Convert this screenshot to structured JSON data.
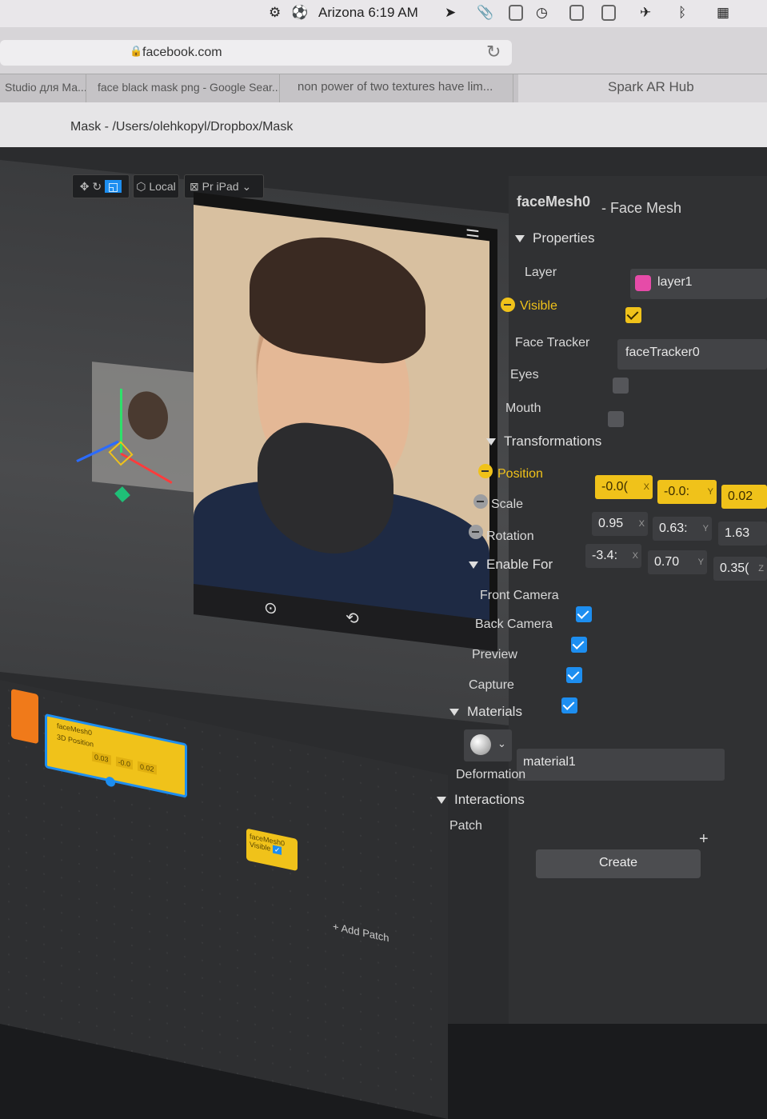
{
  "menubar": {
    "clock": "Arizona 6:19 AM"
  },
  "browser": {
    "url": "facebook.com",
    "tabs": [
      "Studio для Ма...",
      "face black mask png - Google Sear...",
      "non power of two textures have lim...",
      "Spark AR Hub"
    ]
  },
  "window": {
    "title": "Mask - /Users/olehkopyl/Dropbox/Mask"
  },
  "toolbar": {
    "space_label": "Local",
    "device_label": "iPad",
    "view_label": "Pr"
  },
  "inspector": {
    "object_name": "faceMesh0",
    "object_type": "- Face Mesh",
    "properties": {
      "header": "Properties",
      "layer_label": "Layer",
      "layer_value": "layer1",
      "visible_label": "Visible",
      "facetracker_label": "Face Tracker",
      "facetracker_value": "faceTracker0",
      "eyes_label": "Eyes",
      "mouth_label": "Mouth"
    },
    "transformations": {
      "header": "Transformations",
      "position_label": "Position",
      "position": [
        "-0.0(",
        "-0.0:",
        "0.02"
      ],
      "scale_label": "Scale",
      "scale": [
        "0.95",
        "0.63:",
        "1.63"
      ],
      "rotation_label": "Rotation",
      "rotation": [
        "-3.4:",
        "0.70",
        "0.35("
      ]
    },
    "axis": {
      "x": "X",
      "y": "Y",
      "z": "Z"
    },
    "enable_for": {
      "header": "Enable For",
      "front_camera": "Front Camera",
      "back_camera": "Back Camera",
      "preview": "Preview",
      "capture": "Capture"
    },
    "materials": {
      "header": "Materials",
      "value": "material1"
    },
    "deformation": {
      "header": "Deformation"
    },
    "interactions": {
      "header": "Interactions",
      "patch_label": "Patch",
      "create_label": "Create"
    }
  },
  "patch_editor": {
    "node1_title": "faceMesh0",
    "node1_port": "3D Position",
    "node1_values": [
      "0.03",
      "-0.0",
      "0.02"
    ],
    "node2_title": "faceMesh0",
    "node2_port": "Visible",
    "add_patch": "Add Patch"
  },
  "colors": {
    "accent_yellow": "#f0c21a",
    "accent_blue": "#1d8ef0",
    "layer_pink": "#e64ba8",
    "node_orange": "#f07a1a"
  }
}
